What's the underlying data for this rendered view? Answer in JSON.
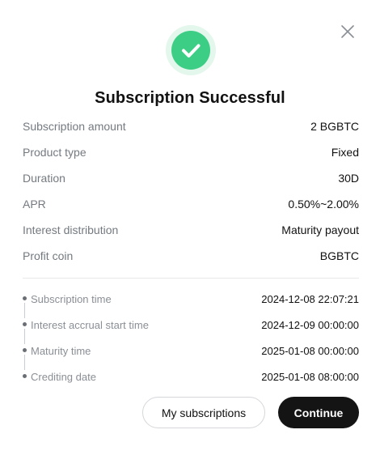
{
  "dialog": {
    "title": "Subscription Successful",
    "accent_color": "#3dce86",
    "close_icon": "close-icon",
    "status_icon": "check-icon"
  },
  "details": [
    {
      "label": "Subscription amount",
      "value": "2 BGBTC"
    },
    {
      "label": "Product type",
      "value": "Fixed"
    },
    {
      "label": "Duration",
      "value": "30D"
    },
    {
      "label": "APR",
      "value": "0.50%~2.00%"
    },
    {
      "label": "Interest distribution",
      "value": "Maturity payout"
    },
    {
      "label": "Profit coin",
      "value": "BGBTC"
    }
  ],
  "timeline": [
    {
      "label": "Subscription time",
      "value": "2024-12-08 22:07:21"
    },
    {
      "label": "Interest accrual start time",
      "value": "2024-12-09 00:00:00"
    },
    {
      "label": "Maturity time",
      "value": "2025-01-08 00:00:00"
    },
    {
      "label": "Crediting date",
      "value": "2025-01-08 08:00:00"
    }
  ],
  "buttons": {
    "secondary_label": "My subscriptions",
    "primary_label": "Continue"
  }
}
